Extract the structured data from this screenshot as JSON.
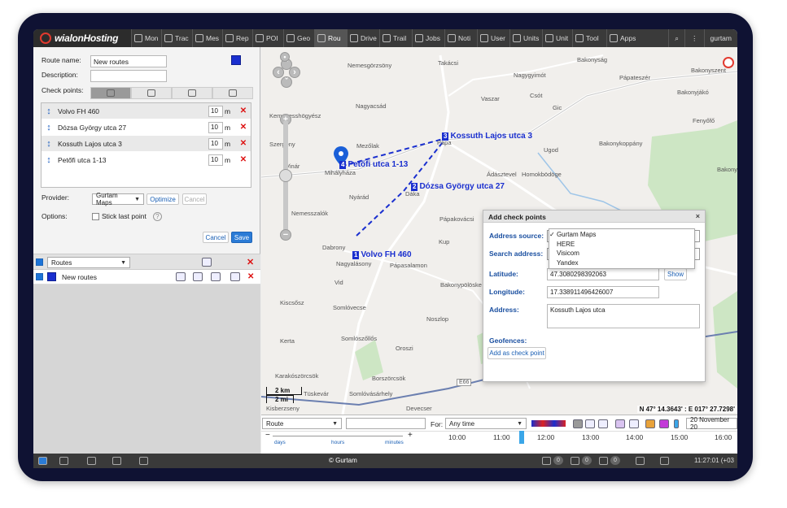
{
  "app": {
    "logo": "wialonHosting"
  },
  "nav": [
    "Mon",
    "Trac",
    "Mes",
    "Rep",
    "POI",
    "Geo",
    "Rou",
    "Drive",
    "Trail",
    "Jobs",
    "Noti",
    "User",
    "Units",
    "Unit",
    "Tool",
    "Apps"
  ],
  "user": "gurtam",
  "form": {
    "route_name_label": "Route name:",
    "route_name_value": "New routes",
    "description_label": "Description:",
    "description_value": "",
    "checkpoints_label": "Check points:",
    "unit": "m",
    "checkpoints": [
      {
        "name": "Volvo FH 460",
        "radius": "10"
      },
      {
        "name": "Dózsa György utca 27",
        "radius": "10"
      },
      {
        "name": "Kossuth Lajos utca 3",
        "radius": "10"
      },
      {
        "name": "Petőfi utca 1-13",
        "radius": "10"
      }
    ],
    "provider_label": "Provider:",
    "provider_value": "Gurtam Maps",
    "optimize": "Optimize",
    "cancel_provider": "Cancel",
    "options_label": "Options:",
    "stick_last_point": "Stick last point",
    "help": "?",
    "cancel": "Cancel",
    "save": "Save"
  },
  "routes_list": {
    "filter_value": "Routes",
    "items": [
      {
        "name": "New routes",
        "color": "#1a2fcf"
      }
    ]
  },
  "map": {
    "towns": [
      "Nemesgörzsöny",
      "Takácsi",
      "Bakonyság",
      "Bakonyszent",
      "Nagygyimót",
      "Pápateszér",
      "Bakonyjákó",
      "Vaszar",
      "Nagyacsád",
      "Csót",
      "Gic",
      "Fenyőfő",
      "Kemenesshögyész",
      "Mezőlak",
      "Pápa",
      "Ugod",
      "Szergény",
      "Bakonykoppány",
      "Vinár",
      "Mihályháza",
      "Ádásztevel",
      "Homokbödöge",
      "Bakonybél",
      "Nyárád",
      "Dáka",
      "Nemesszalók",
      "Pápakovácsi",
      "Kup",
      "Dabrony",
      "Nagyalásony",
      "Pápasalamon",
      "Vid",
      "Bakonypölöske",
      "Kiscsősz",
      "Somlóvecse",
      "Noszlop",
      "Kerta",
      "Somlószőllős",
      "Oroszi",
      "Karakószörcsök",
      "Borszörcsök",
      "Tüskevár",
      "Somlóvásárhely",
      "Kisberzseny",
      "Devecser"
    ],
    "checkpoint_labels": [
      {
        "num": "1",
        "name": "Volvo FH 460"
      },
      {
        "num": "2",
        "name": "Dózsa György utca 27"
      },
      {
        "num": "3",
        "name": "Kossuth Lajos utca 3"
      },
      {
        "num": "4",
        "name": "Petőfi utca 1-13"
      }
    ],
    "scale_km": "2 km",
    "scale_mi": "2 mi",
    "coords": "N 47° 14.3643' : E 017° 27.7298'",
    "road_label": "E66"
  },
  "dialog": {
    "title": "Add check points",
    "close": "×",
    "address_source_label": "Address source:",
    "search_address_label": "Search address:",
    "latitude_label": "Latitude:",
    "latitude_value": "47.3080298392063",
    "longitude_label": "Longitude:",
    "longitude_value": "17.338911496426007",
    "address_label": "Address:",
    "address_value": "Kossuth Lajos utca",
    "geofences_label": "Geofences:",
    "add_as_checkpoint": "Add as check point",
    "show": "Show",
    "sources": [
      "Gurtam Maps",
      "HERE",
      "Visicom",
      "Yandex"
    ],
    "selected_source": "Gurtam Maps"
  },
  "timeline": {
    "route_select": "Route",
    "for_label": "For:",
    "period_value": "Any time",
    "date": "20 November 20",
    "times": [
      "10:00",
      "11:00",
      "12:00",
      "13:00",
      "14:00",
      "15:00",
      "16:00"
    ],
    "zoom_labels": [
      "days",
      "hours",
      "minutes"
    ],
    "minus": "−",
    "plus": "+"
  },
  "bottom": {
    "copyright": "© Gurtam",
    "time": "11:27:01 (+03",
    "counts": [
      "0",
      "0",
      "0",
      "0"
    ]
  },
  "colors": {
    "route": "#1a2fcf",
    "accent": "#2b7bd6",
    "delete": "#dd1111"
  }
}
